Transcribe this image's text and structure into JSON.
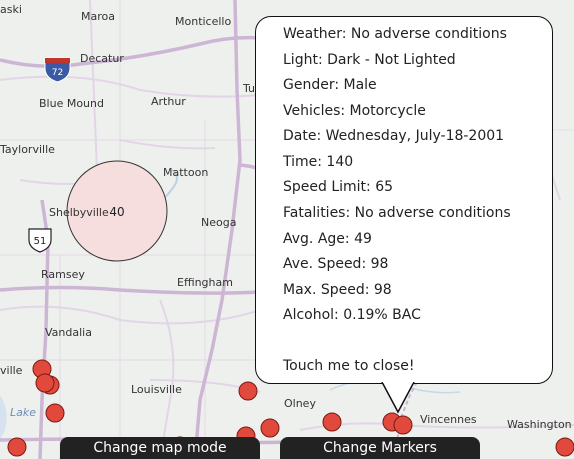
{
  "map": {
    "cities": [
      {
        "id": "maroa",
        "name": "Maroa"
      },
      {
        "id": "monticello",
        "name": "Monticello"
      },
      {
        "id": "decatur",
        "name": "Decatur"
      },
      {
        "id": "blue-mound",
        "name": "Blue Mound"
      },
      {
        "id": "arthur",
        "name": "Arthur"
      },
      {
        "id": "taylorville",
        "name": "Taylorville"
      },
      {
        "id": "mattoon",
        "name": "Mattoon"
      },
      {
        "id": "shelbyville",
        "name": "Shelbyville"
      },
      {
        "id": "neoga",
        "name": "Neoga"
      },
      {
        "id": "ramsey",
        "name": "Ramsey"
      },
      {
        "id": "effingham",
        "name": "Effingham"
      },
      {
        "id": "vandalia",
        "name": "Vandalia"
      },
      {
        "id": "louisville",
        "name": "Louisville"
      },
      {
        "id": "olney",
        "name": "Olney"
      },
      {
        "id": "vincennes",
        "name": "Vincennes"
      },
      {
        "id": "washington",
        "name": "Washington"
      },
      {
        "id": "aski",
        "name": "aski"
      },
      {
        "id": "ville",
        "name": "ville"
      },
      {
        "id": "lake",
        "name": "Lake"
      },
      {
        "id": "tu",
        "name": "Tu"
      }
    ],
    "shields": [
      {
        "id": "i72",
        "label": "72",
        "kind": "interstate"
      },
      {
        "id": "us51",
        "label": "51",
        "kind": "us-route"
      }
    ],
    "cluster": {
      "count": "40"
    },
    "marker_count": 14
  },
  "popup": {
    "lines": [
      "Weather: No adverse conditions",
      "Light: Dark - Not Lighted",
      "Gender: Male",
      "Vehicles: Motorcycle",
      "Date: Wednesday, July-18-2001",
      "Time: 140",
      "Speed Limit: 65",
      "Fatalities: No adverse conditions",
      "Avg. Age: 49",
      "Ave. Speed: 98",
      "Max. Speed: 98",
      "Alcohol: 0.19% BAC"
    ],
    "close_text": "Touch me to close!"
  },
  "buttons": {
    "map_mode": "Change map mode",
    "markers": "Change Markers"
  },
  "colors": {
    "marker_fill": "#e0493b",
    "marker_stroke": "#7a1a12",
    "cluster_fill": "#f7dede",
    "road_major": "#cdb6d4",
    "road_minor": "#e2d6e6",
    "button_bg": "#222222"
  }
}
